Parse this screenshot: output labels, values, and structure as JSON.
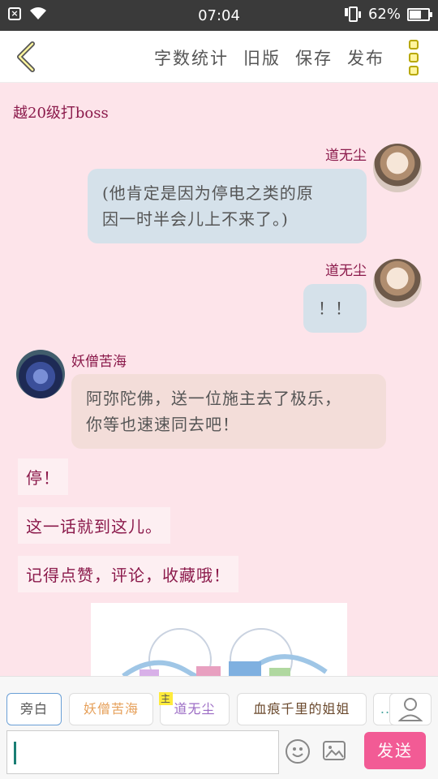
{
  "status_bar": {
    "time": "07:04",
    "battery_percent": "62%",
    "battery_level": 0.62
  },
  "top_bar": {
    "actions": [
      "字数统计",
      "旧版",
      "保存",
      "发布"
    ]
  },
  "chapter_title": "越20级打boss",
  "messages": [
    {
      "side": "right",
      "name": "道无尘",
      "lines": [
        "(他肯定是因为停电之类的原",
        "因一时半会儿上不来了。)"
      ]
    },
    {
      "side": "right",
      "name": "道无尘",
      "lines": [
        "！！"
      ]
    },
    {
      "side": "left",
      "name": "妖僧苦海",
      "lines": [
        "阿弥陀佛，送一位施主去了极乐，",
        "你等也速速同去吧！"
      ]
    }
  ],
  "narration": [
    "停！",
    "这一话就到这儿。",
    "记得点赞，评论，收藏哦！"
  ],
  "characters": [
    {
      "label": "旁白",
      "selected": true,
      "color": "#555555"
    },
    {
      "label": "妖僧苦海",
      "selected": false,
      "color": "#e6a05a"
    },
    {
      "label": "道无尘",
      "selected": false,
      "color": "#9b6bc4",
      "badge": "主"
    },
    {
      "label": "血痕千里的姐姐",
      "selected": false,
      "color": "#6b4a2e"
    },
    {
      "label": "..",
      "selected": false,
      "color": "#4aa6a0"
    }
  ],
  "input": {
    "value": "",
    "send_label": "发送"
  },
  "colors": {
    "accent": "#f25b95",
    "name": "#8b1a4b",
    "background": "#fde4ea"
  }
}
